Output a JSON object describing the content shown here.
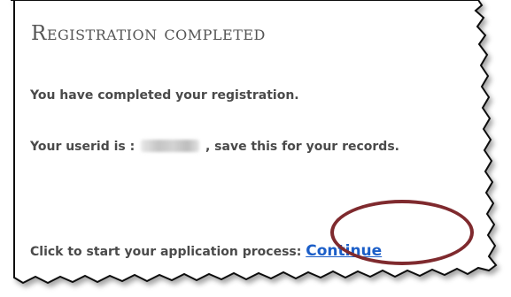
{
  "panel": {
    "title": "Registration completed",
    "completed_message": "You have completed your registration.",
    "userid_prefix": "Your userid is :",
    "userid_value": "",
    "userid_suffix": ", save this for your records.",
    "start_prompt": "Click to start your application process:",
    "continue_label": "Continue"
  },
  "colors": {
    "text": "#4a4a4a",
    "title": "#555555",
    "link": "#1b5ec8",
    "highlight_circle": "#7f2a2e",
    "torn_edge": "#111111"
  }
}
